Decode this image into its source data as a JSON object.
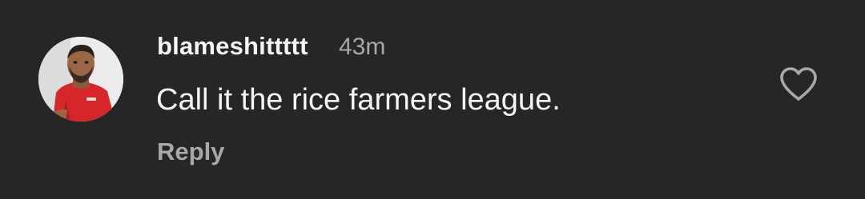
{
  "comment": {
    "username": "blameshittttt",
    "time": "43m",
    "text": "Call it the rice farmers league.",
    "reply_label": "Reply",
    "avatar_icon": "user-avatar",
    "like_icon": "heart-outline-icon",
    "liked": false
  },
  "colors": {
    "background": "#262626",
    "primary_text": "#f5f5f5",
    "secondary_text": "#a8a8a8"
  }
}
